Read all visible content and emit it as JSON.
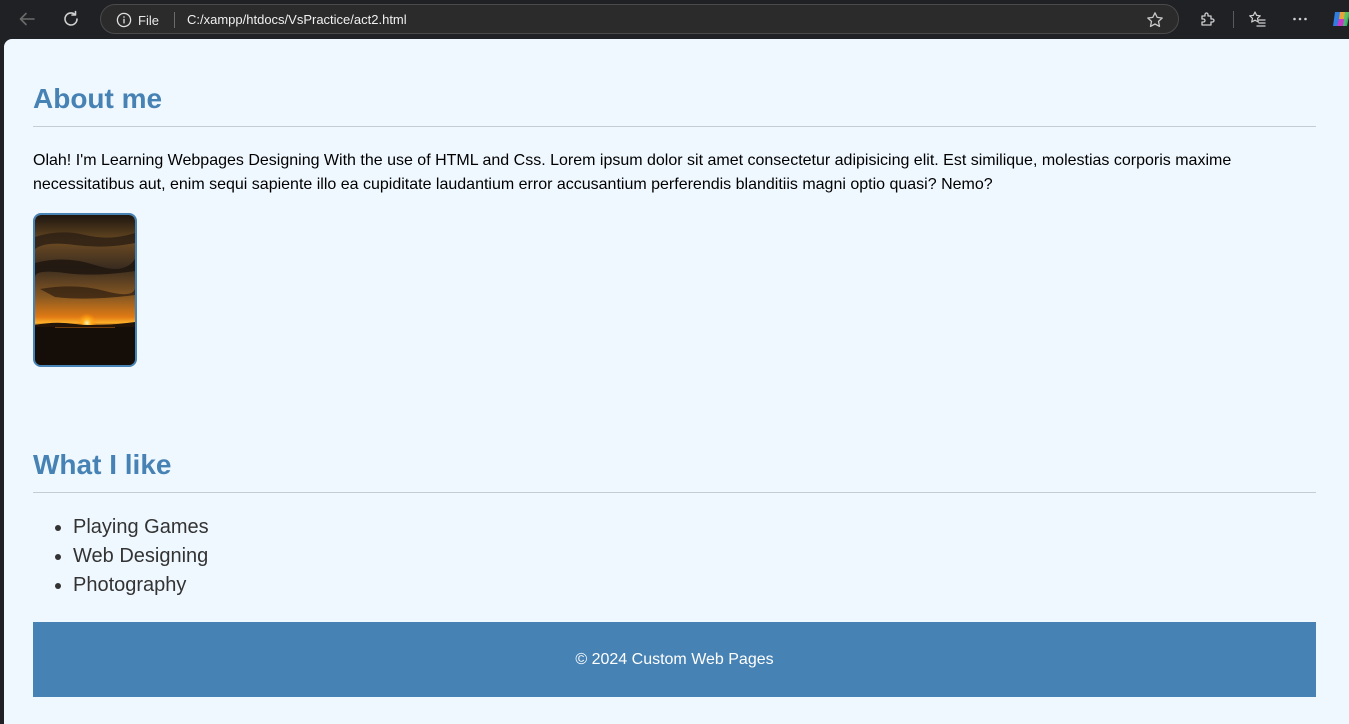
{
  "browser": {
    "site_info_label": "File",
    "url": "C:/xampp/htdocs/VsPractice/act2.html",
    "icons": [
      "back-icon",
      "reload-icon",
      "info-icon",
      "star-icon",
      "extensions-icon",
      "favorites-icon",
      "more-icon",
      "copilot-icon"
    ]
  },
  "page": {
    "about": {
      "heading": "About me",
      "text": "Olah! I'm Learning Webpages Designing With the use of HTML and Css. Lorem ipsum dolor sit amet consectetur adipisicing elit. Est similique, molestias corporis maxime necessitatibus aut, enim sequi sapiente illo ea cupiditate laudantium error accusantium perferendis blanditiis magni optio quasi? Nemo?"
    },
    "likes": {
      "heading": "What I like",
      "items": [
        "Playing Games",
        "Web Designing",
        "Photography"
      ]
    },
    "footer": {
      "text": "© 2024 Custom Web Pages"
    }
  },
  "colors": {
    "accent": "#4682b4",
    "page_background": "#f0f8ff"
  }
}
